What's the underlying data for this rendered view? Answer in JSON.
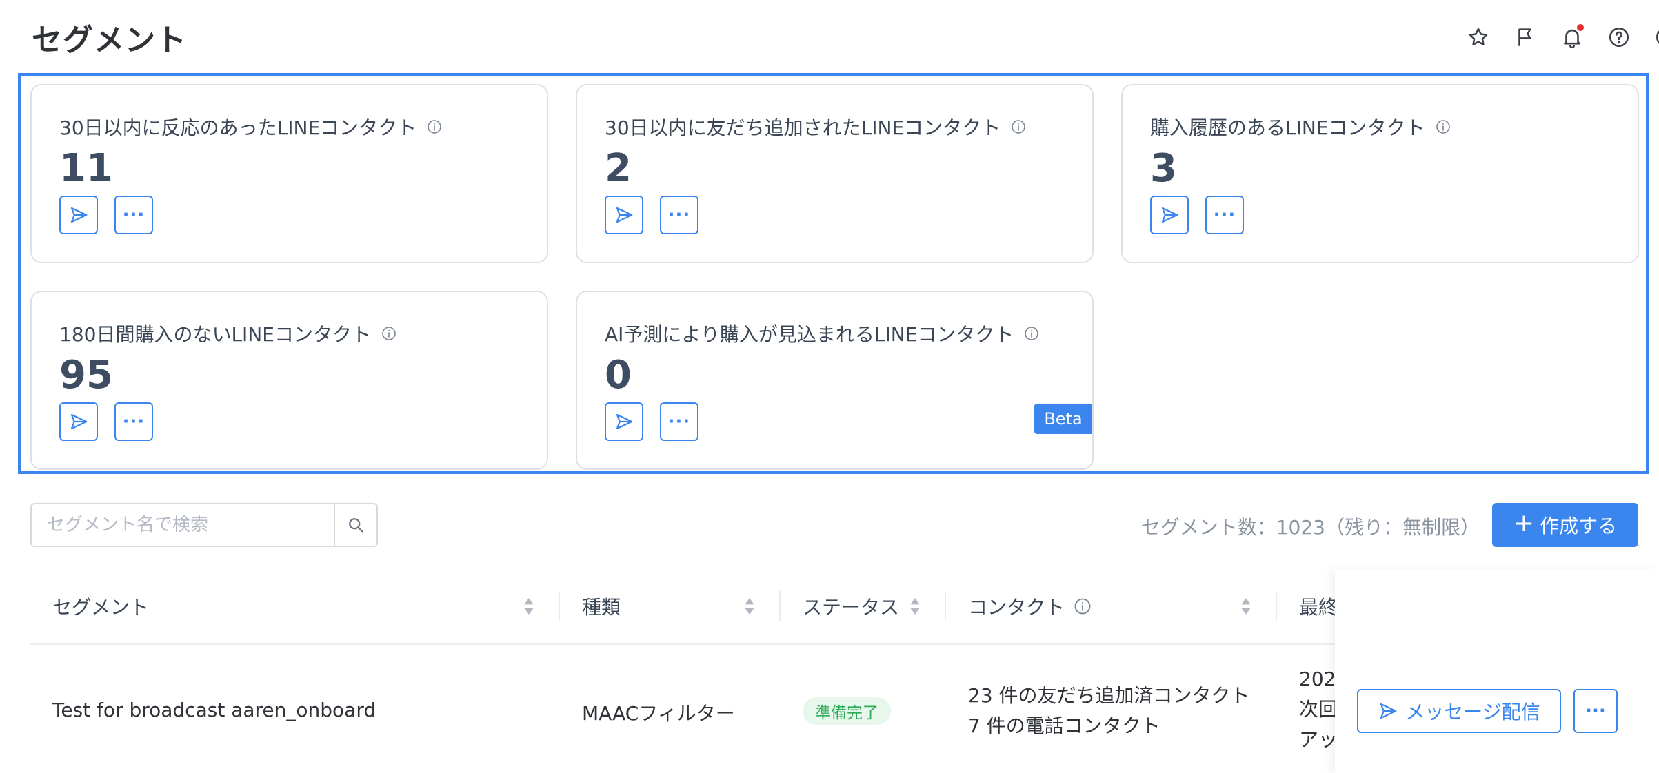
{
  "page": {
    "title": "セグメント"
  },
  "top_icons": [
    "star-icon",
    "flag-icon",
    "bell-icon",
    "help-icon",
    "account-icon"
  ],
  "accent_color": "#3a86ee",
  "cards": [
    {
      "title": "30日以内に反応のあったLINEコンタクト",
      "count": "11",
      "more": "···"
    },
    {
      "title": "30日以内に友だち追加されたLINEコンタクト",
      "count": "2",
      "more": "···"
    },
    {
      "title": "購入履歴のあるLINEコンタクト",
      "count": "3",
      "more": "···"
    },
    {
      "title": "180日間購入のないLINEコンタクト",
      "count": "95",
      "more": "···"
    },
    {
      "title": "AI予測により購入が見込まれるLINEコンタクト",
      "count": "0",
      "more": "···",
      "badge": "Beta"
    }
  ],
  "search": {
    "placeholder": "セグメント名で検索"
  },
  "segment_count": "セグメント数：1023（残り：無制限）",
  "create_button": {
    "plus": "+",
    "label": "作成する"
  },
  "table": {
    "headers": {
      "segment": "セグメント",
      "type": "種類",
      "status": "ステータス",
      "contacts": "コンタクト",
      "last": "最終"
    },
    "rows": [
      {
        "name": "Test for broadcast aaren_onboard",
        "type": "MAACフィルター",
        "status": "準備完了",
        "contacts_line1": "23 件の友だち追加済コンタクト",
        "contacts_line2": "7 件の電話コンタクト",
        "last_line1": "202",
        "last_line2": "次回",
        "last_line3": "アッ",
        "action_label": "メッセージ配信",
        "more": "···"
      }
    ]
  }
}
